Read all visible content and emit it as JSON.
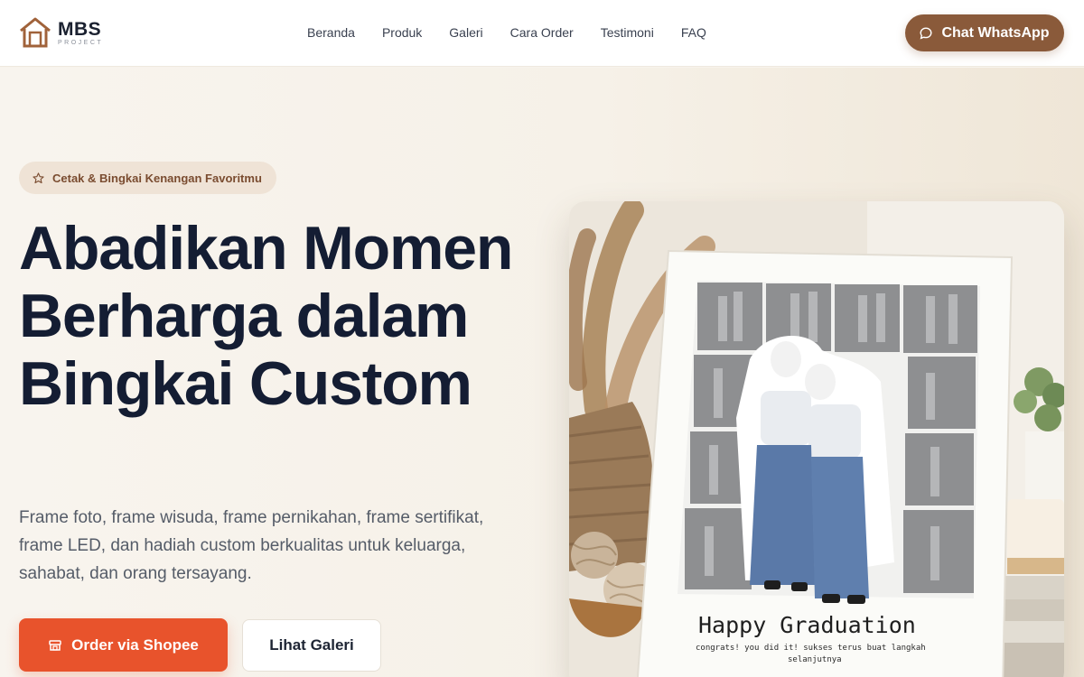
{
  "brand": {
    "name": "MBS",
    "tagline": "PROJECT",
    "accent": "#8a5a3a"
  },
  "nav": {
    "items": [
      "Beranda",
      "Produk",
      "Galeri",
      "Cara Order",
      "Testimoni",
      "FAQ"
    ]
  },
  "header": {
    "cta_label": "Chat WhatsApp",
    "cta_icon": "chat-bubble-icon"
  },
  "hero": {
    "badge": {
      "icon": "star-icon",
      "label": "Cetak & Bingkai Kenangan Favoritmu"
    },
    "title": "Abadikan Momen Berharga dalam Bingkai Custom",
    "description": "Frame foto, frame wisuda, frame pernikahan, frame sertifikat, frame LED, dan hadiah custom berkualitas untuk keluarga, sahabat, dan orang tersayang.",
    "primary_button": {
      "label": "Order via Shopee",
      "icon": "store-icon",
      "color": "#e8532c"
    },
    "secondary_button": {
      "label": "Lihat Galeri"
    },
    "image": {
      "frame_title": "Happy Graduation",
      "frame_caption_line1": "congrats! you did it! sukses terus buat langkah",
      "frame_caption_line2": "selanjutnya"
    }
  }
}
